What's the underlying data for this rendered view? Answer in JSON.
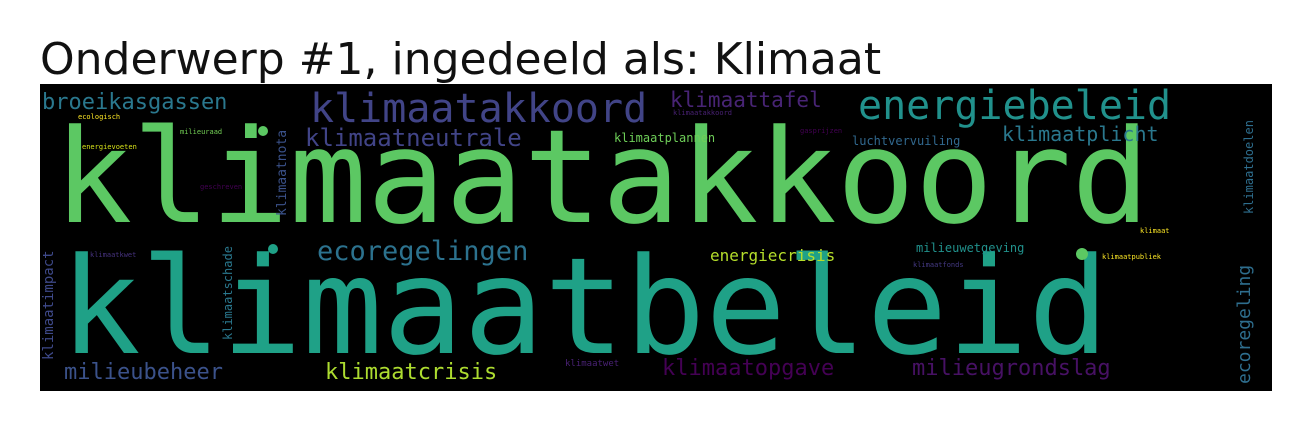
{
  "title": "Onderwerp #1, ingedeeld als: Klimaat",
  "words": [
    {
      "text": "klimaatakkoord",
      "color": "#5cc863"
    },
    {
      "text": "klimaatbeleid",
      "color": "#1fa187"
    },
    {
      "text": "klimaatakkoord",
      "color": "#414487"
    },
    {
      "text": "energiebeleid",
      "color": "#21918c"
    },
    {
      "text": "broeikasgassen",
      "color": "#2a788e"
    },
    {
      "text": "klimaattafel",
      "color": "#482475"
    },
    {
      "text": "klimaatneutrale",
      "color": "#414487"
    },
    {
      "text": "klimaatplicht",
      "color": "#2a788e"
    },
    {
      "text": "klimaatplannen",
      "color": "#6ece58"
    },
    {
      "text": "luchtvervuiling",
      "color": "#31688e"
    },
    {
      "text": "ecoregelingen",
      "color": "#2c728e"
    },
    {
      "text": "energiecrisis",
      "color": "#b5de2b"
    },
    {
      "text": "milieuwetgeving",
      "color": "#21918c"
    },
    {
      "text": "milieubeheer",
      "color": "#3b528b"
    },
    {
      "text": "klimaatcrisis",
      "color": "#addc30"
    },
    {
      "text": "klimaatopgave",
      "color": "#440154"
    },
    {
      "text": "milieugrondslag",
      "color": "#471164"
    },
    {
      "text": "klimaatwet",
      "color": "#482173"
    },
    {
      "text": "ecoregeling",
      "color": "#2e6e8e"
    },
    {
      "text": "klimaatimpact",
      "color": "#3e4989"
    },
    {
      "text": "klimaatnota",
      "color": "#3b528b"
    },
    {
      "text": "klimaatdoelen",
      "color": "#2e6e8e"
    },
    {
      "text": "klimaatschade",
      "color": "#2a788e"
    },
    {
      "text": "ecologisch",
      "color": "#fde725"
    },
    {
      "text": "energievoeten",
      "color": "#d8e219"
    },
    {
      "text": "milieuraad",
      "color": "#73d055"
    },
    {
      "text": "geschreven",
      "color": "#440154"
    },
    {
      "text": "gasprijzen",
      "color": "#440154"
    },
    {
      "text": "klimaatkwet",
      "color": "#46327e"
    },
    {
      "text": "klimaatfonds",
      "color": "#443983"
    },
    {
      "text": "klimaatakkoord",
      "color": "#482173"
    },
    {
      "text": "klimaatpubliek",
      "color": "#fde725"
    },
    {
      "text": "klimaat",
      "color": "#fde725"
    }
  ]
}
